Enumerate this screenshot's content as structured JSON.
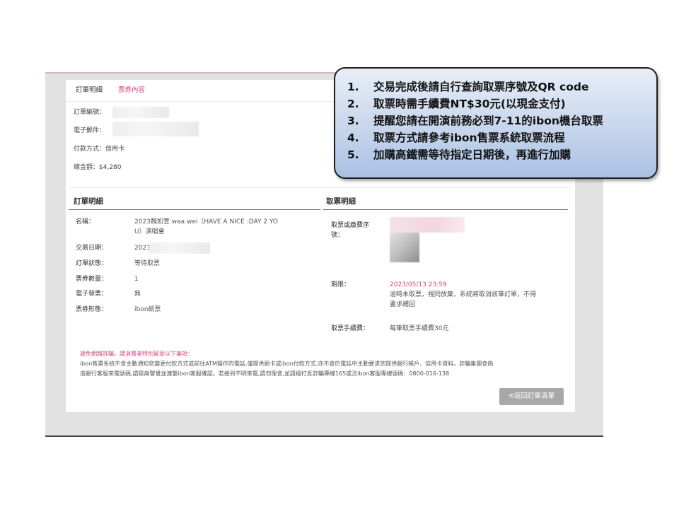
{
  "tabs": [
    {
      "label": "訂單明細",
      "active": true
    },
    {
      "label": "票券內容",
      "active": false
    }
  ],
  "order_info": {
    "order_no_label": "訂單編號：",
    "email_label": "電子郵件：",
    "payment_label": "付款方式：信用卡",
    "total_label": "總金額：$4,280"
  },
  "order_detail": {
    "title": "訂單明細",
    "name_label": "名稱：",
    "name_value_line1": "2023魏如萱 waa wei〔HAVE A NICE :DAY 2 YO",
    "name_value_line2": "U〕演唱會",
    "date_label": "交易日期：",
    "date_value": "2023",
    "status_label": "訂單狀態：",
    "status_value": "等待取票",
    "qty_label": "票券數量：",
    "qty_value": "1",
    "invoice_label": "電子發票：",
    "invoice_value": "無",
    "ticket_type_label": "票券形態：",
    "ticket_type_value": "ibon紙票"
  },
  "pickup_detail": {
    "title": "取票明細",
    "code_label_line1": "取票或繳費序",
    "code_label_line2": "號：",
    "deadline_label": "期限：",
    "deadline_value": "2023/05/13  23:59",
    "deadline_note_line1": "逾時未取票，視同放棄，系統將取消該筆訂單，不得",
    "deadline_note_line2": "要求補回",
    "fee_label": "取票手續費：",
    "fee_value": "每筆取票手續費30元"
  },
  "notice": {
    "title": "避免網路詐騙，請消費者特別留意以下事項：",
    "line1": "ibon售票系統不會主動通知您變更付款方式或前往ATM操作的電話,僅提供刷卡或ibon付款方式,亦不會於電話中主動要求您提供銀行帳戶、信用卡資料。詐騙集團會偽",
    "line2": "造銀行客服來電號碼,請提高警覺並連繫ibon客服確認。若接到不明來電,請勿理會,並請撥打反詐騙專線165或洽ibon客服專線號碼：0800-016-138"
  },
  "back_button": {
    "icon": "refresh-icon",
    "label": "返回訂單清單"
  },
  "callout": {
    "items": [
      {
        "num": "1.",
        "text": "交易完成後請自行查詢取票序號及QR code"
      },
      {
        "num": "2.",
        "text": "取票時需手續費NT$30元(以現金支付)"
      },
      {
        "num": "3.",
        "text": "提醒您請在開演前務必到7-11的ibon機台取票"
      },
      {
        "num": "4.",
        "text": "取票方式請參考ibon售票系統取票流程"
      },
      {
        "num": "5.",
        "text": "加購高鐵需等待指定日期後，再進行加購"
      }
    ]
  },
  "colors": {
    "accent": "#d7457f",
    "button": "#a8a8a8",
    "callout_fill": "#c7d6ec"
  }
}
